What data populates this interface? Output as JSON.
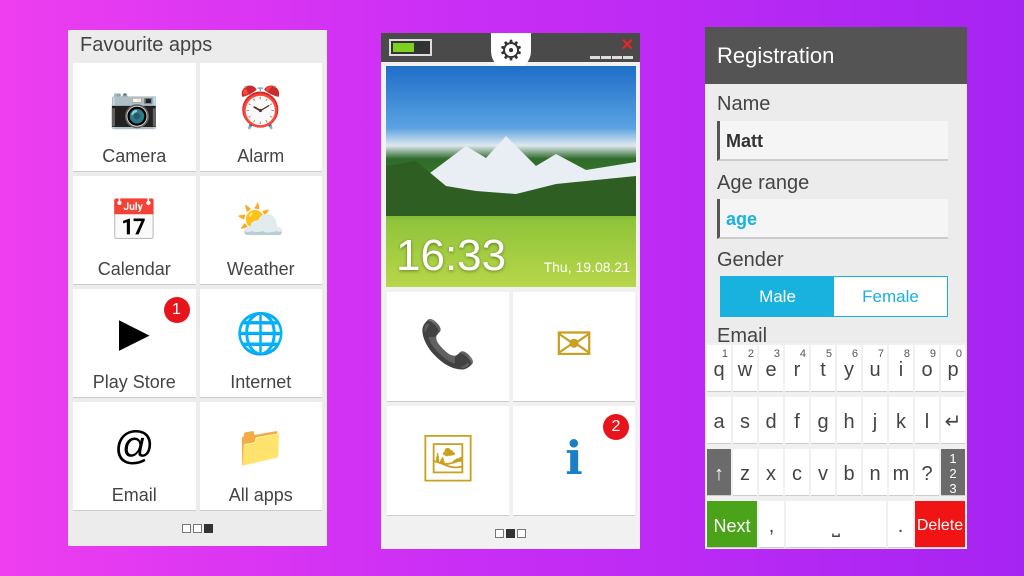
{
  "favourites": {
    "title": "Favourite apps",
    "apps": [
      {
        "label": "Camera",
        "icon": "camera-icon"
      },
      {
        "label": "Alarm",
        "icon": "alarm-clock-icon"
      },
      {
        "label": "Calendar",
        "icon": "calendar-icon"
      },
      {
        "label": "Weather",
        "icon": "weather-icon"
      },
      {
        "label": "Play Store",
        "icon": "play-store-icon",
        "badge": "1"
      },
      {
        "label": "Internet",
        "icon": "globe-icon"
      },
      {
        "label": "Email",
        "icon": "email-icon"
      },
      {
        "label": "All apps",
        "icon": "folder-icon"
      }
    ],
    "page": 3,
    "pages": 3
  },
  "home": {
    "battery_level": 0.55,
    "time": "16:33",
    "date": "Thu, 19.08.21",
    "tiles": [
      {
        "icon": "phone-icon"
      },
      {
        "icon": "message-icon"
      },
      {
        "icon": "gallery-icon"
      },
      {
        "icon": "info-icon",
        "badge": "2"
      }
    ],
    "page": 2,
    "pages": 3
  },
  "registration": {
    "title": "Registration",
    "name_label": "Name",
    "name_value": "Matt",
    "age_label": "Age range",
    "age_value": "age",
    "gender_label": "Gender",
    "gender_options": [
      "Male",
      "Female"
    ],
    "gender_selected": "Male",
    "email_label": "Email",
    "accent": "#19b1de",
    "keyboard": {
      "row1": [
        [
          "q",
          "1"
        ],
        [
          "w",
          "2"
        ],
        [
          "e",
          "3"
        ],
        [
          "r",
          "4"
        ],
        [
          "t",
          "5"
        ],
        [
          "y",
          "6"
        ],
        [
          "u",
          "7"
        ],
        [
          "i",
          "8"
        ],
        [
          "o",
          "9"
        ],
        [
          "p",
          "0"
        ]
      ],
      "row2": [
        "a",
        "s",
        "d",
        "f",
        "g",
        "h",
        "j",
        "k",
        "l",
        "↵"
      ],
      "row3": [
        "↑",
        "z",
        "x",
        "c",
        "v",
        "b",
        "n",
        "m",
        "?",
        "1 2 3"
      ],
      "next": "Next",
      "comma": ",",
      "space": "⎵",
      "period": ".",
      "delete": "Delete"
    }
  }
}
